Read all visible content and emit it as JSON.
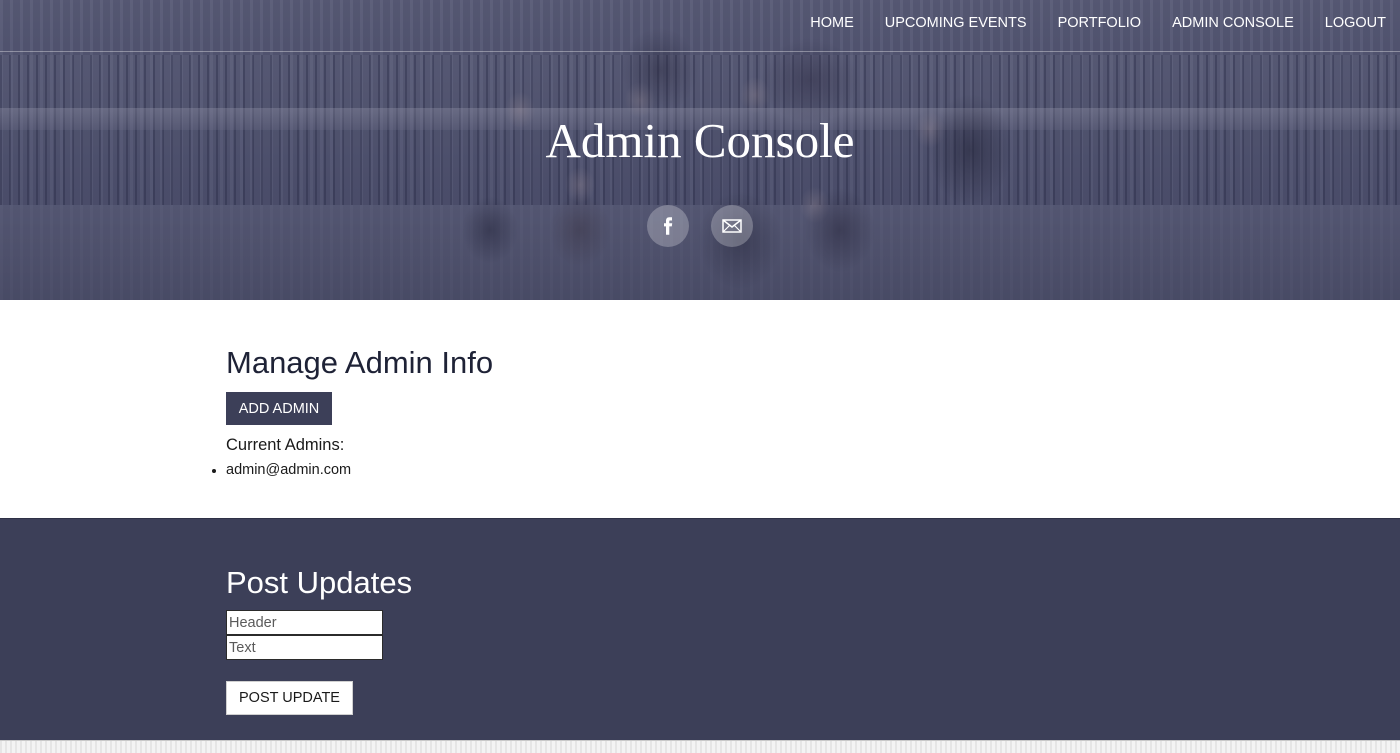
{
  "nav": {
    "items": [
      {
        "label": "HOME"
      },
      {
        "label": "UPCOMING EVENTS"
      },
      {
        "label": "PORTFOLIO"
      },
      {
        "label": "ADMIN CONSOLE"
      },
      {
        "label": "LOGOUT"
      }
    ]
  },
  "hero": {
    "title": "Admin Console",
    "social": [
      {
        "icon": "facebook-icon",
        "glyph": "f"
      },
      {
        "icon": "mail-icon",
        "glyph": "✉"
      }
    ]
  },
  "manage": {
    "heading": "Manage Admin Info",
    "add_button": "ADD ADMIN",
    "current_label": "Current Admins:",
    "admins": [
      "admin@admin.com"
    ]
  },
  "updates": {
    "heading": "Post Updates",
    "header_placeholder": "Header",
    "text_placeholder": "Text",
    "post_button": "POST UPDATE"
  },
  "colors": {
    "primary": "#3c3f58",
    "hero_overlay": "#4a4d6a",
    "text_dark": "#1e2236",
    "white": "#ffffff"
  }
}
